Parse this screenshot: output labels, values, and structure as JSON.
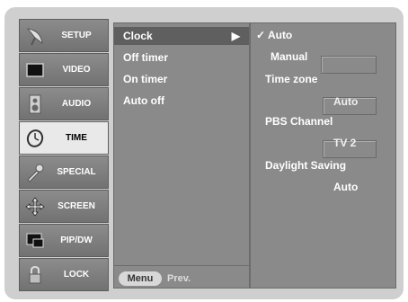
{
  "sidebar": {
    "items": [
      {
        "label": "SETUP",
        "icon": "satellite-dish-icon"
      },
      {
        "label": "VIDEO",
        "icon": "monitor-icon"
      },
      {
        "label": "AUDIO",
        "icon": "speaker-icon"
      },
      {
        "label": "TIME",
        "icon": "clock-icon"
      },
      {
        "label": "SPECIAL",
        "icon": "wrench-icon"
      },
      {
        "label": "SCREEN",
        "icon": "move-arrows-icon"
      },
      {
        "label": "PIP/DW",
        "icon": "pip-windows-icon"
      },
      {
        "label": "LOCK",
        "icon": "padlock-icon"
      }
    ],
    "active": "TIME"
  },
  "menu": {
    "items": [
      {
        "label": "Clock",
        "arrow": "▶"
      },
      {
        "label": "Off timer"
      },
      {
        "label": "On timer"
      },
      {
        "label": "Auto off"
      }
    ],
    "selected": "Clock"
  },
  "footer": {
    "menu_key": "Menu",
    "prev_label": "Prev."
  },
  "submenu": {
    "auto_option": "✓ Auto",
    "manual_option": "Manual",
    "time_zone_label": "Time zone",
    "time_zone_value": "Auto",
    "pbs_channel_label": "PBS Channel",
    "pbs_channel_value": "TV 2",
    "daylight_saving_label": "Daylight Saving",
    "daylight_saving_value": "Auto"
  },
  "colors": {
    "panel": "#8a8a8a",
    "highlight": "#5f5f5f",
    "frame": "#cfcfcf"
  }
}
